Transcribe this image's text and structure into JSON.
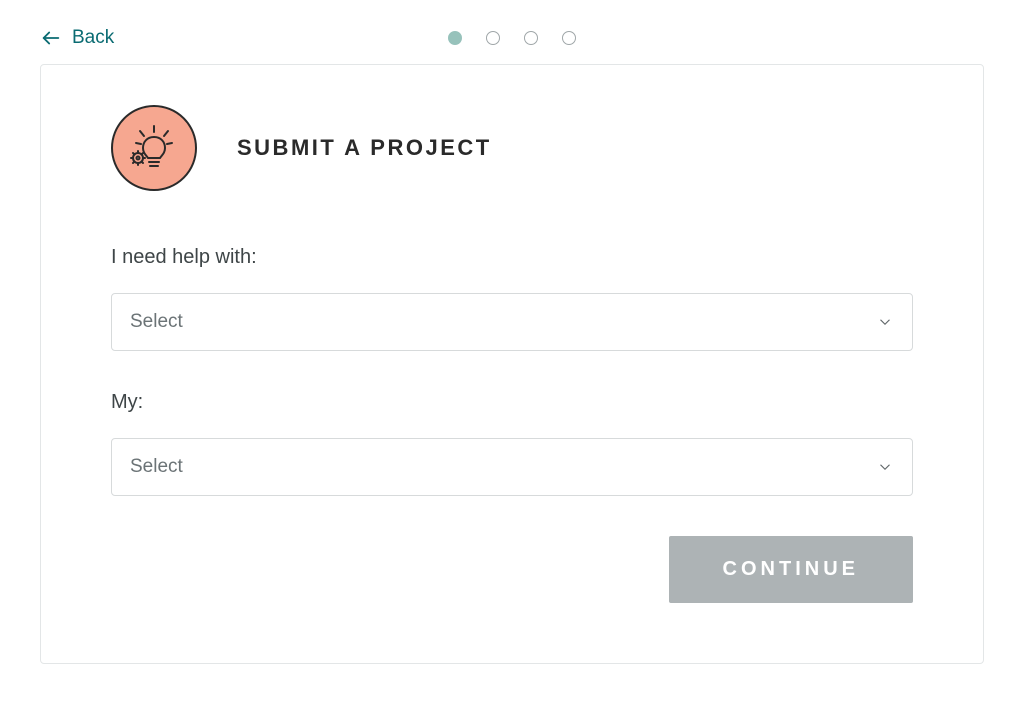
{
  "nav": {
    "back_label": "Back"
  },
  "stepper": {
    "total": 4,
    "active_index": 0
  },
  "header": {
    "title": "SUBMIT A PROJECT",
    "icon": "lightbulb-gear-icon"
  },
  "form": {
    "help_label": "I need help with:",
    "help_selected": "Select",
    "my_label": "My:",
    "my_selected": "Select"
  },
  "actions": {
    "continue_label": "CONTINUE"
  },
  "colors": {
    "accent_teal": "#0a6b72",
    "step_active": "#97c2bb",
    "icon_bg": "#f6a790",
    "button_disabled": "#adb3b5"
  }
}
